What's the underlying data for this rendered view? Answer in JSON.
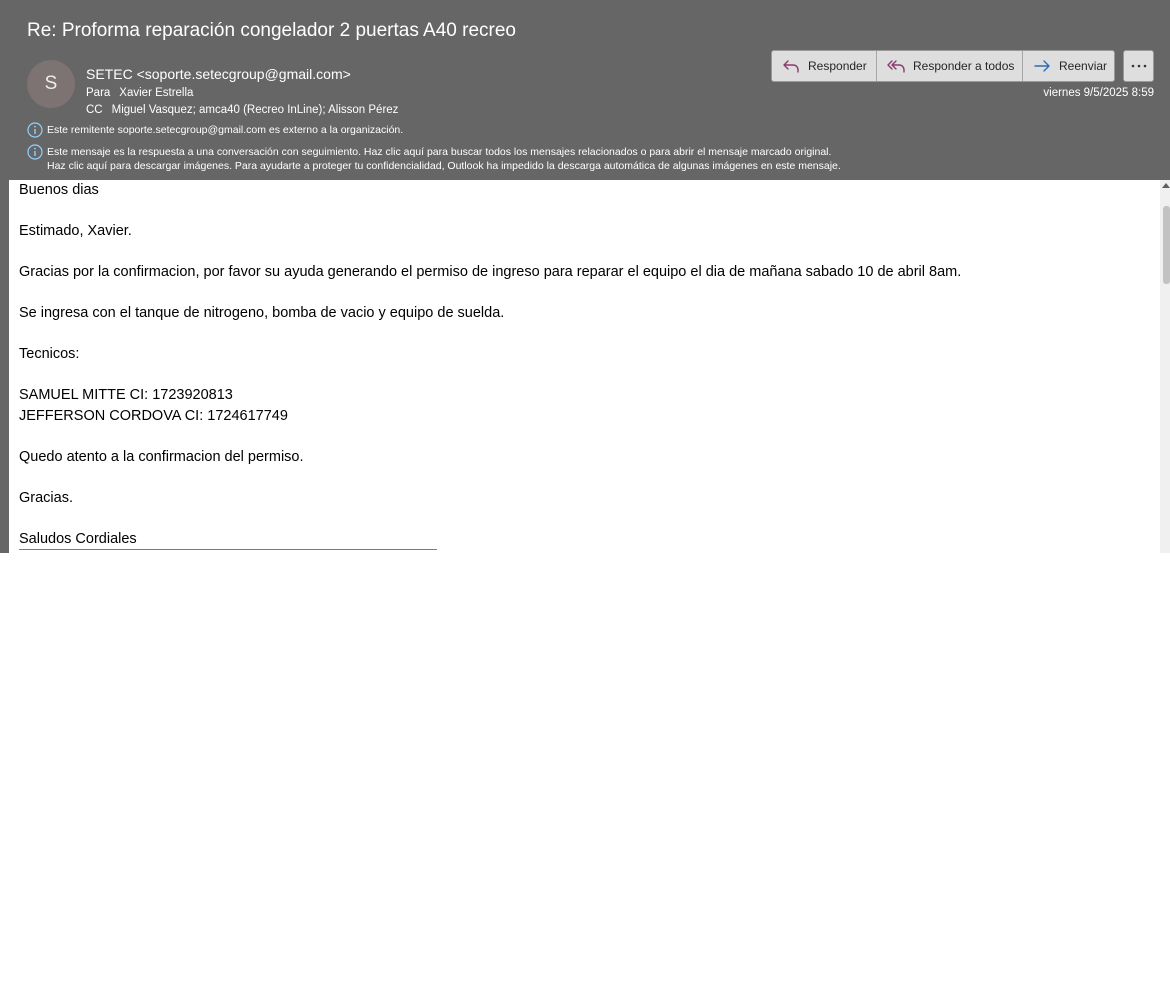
{
  "message": {
    "subject": "Re: Proforma reparación congelador 2 puertas A40 recreo",
    "avatar_initial": "S",
    "sender": "SETEC <soporte.setecgroup@gmail.com>",
    "to_label": "Para",
    "to_value": "Xavier Estrella",
    "cc_label": "CC",
    "cc_value": "Miguel Vasquez; amca40 (Recreo InLine); Alisson Pérez",
    "date": "viernes 9/5/2025 8:59"
  },
  "toolbar": {
    "reply_label": "Responder",
    "reply_all_label": "Responder a todos",
    "forward_label": "Reenviar",
    "more_icon": "ellipsis-icon"
  },
  "notices": {
    "external": "Este remitente soporte.setecgroup@gmail.com es externo a la organización.",
    "conversation": "Este mensaje es la respuesta a una conversación con seguimiento. Haz clic aquí para buscar todos los mensajes relacionados o para abrir el mensaje marcado original.",
    "images": "Haz clic aquí para descargar imágenes. Para ayudarte a proteger tu confidencialidad, Outlook ha impedido la descarga automática de algunas imágenes en este mensaje."
  },
  "body": {
    "greeting": "Buenos dias",
    "salutation": "Estimado, Xavier.",
    "request": "Gracias por la confirmacion, por favor su ayuda generando el permiso de ingreso para reparar el equipo el dia de mañana sabado 10 de abril 8am.",
    "equipment": "Se ingresa con el tanque de nitrogeno, bomba de vacio y equipo de suelda.",
    "techs_heading": "Tecnicos:",
    "tech_1": "SAMUEL MITTE  CI: 1723920813",
    "tech_2": "JEFFERSON CORDOVA  CI: 1724617749",
    "closing": "Quedo atento a la confirmacion del permiso.",
    "thanks": "Gracias.",
    "signoff": "Saludos Cordiales"
  },
  "colors": {
    "header_bg": "#666666",
    "info_icon": "#8fd0ff",
    "reply_icon": "#8a3a6e",
    "forward_icon": "#2b6cb3"
  }
}
